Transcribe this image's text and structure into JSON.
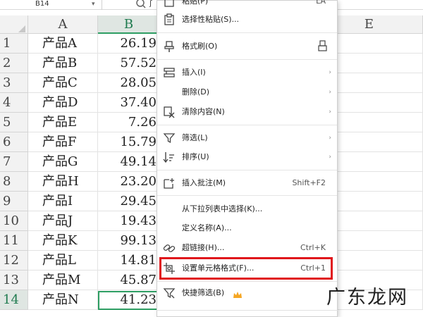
{
  "formula_bar": {
    "name_box": "B14",
    "name_box_caret": "▾",
    "formula_fragment": "ʃ"
  },
  "columns": [
    "A",
    "B",
    "E"
  ],
  "rows": [
    {
      "num": "1",
      "a": "产品A",
      "b": "26.19"
    },
    {
      "num": "2",
      "a": "产品B",
      "b": "57.52"
    },
    {
      "num": "3",
      "a": "产品C",
      "b": "28.05"
    },
    {
      "num": "4",
      "a": "产品D",
      "b": "37.40"
    },
    {
      "num": "5",
      "a": "产品E",
      "b": "7.26"
    },
    {
      "num": "6",
      "a": "产品F",
      "b": "15.79"
    },
    {
      "num": "7",
      "a": "产品G",
      "b": "49.14"
    },
    {
      "num": "8",
      "a": "产品H",
      "b": "23.20"
    },
    {
      "num": "9",
      "a": "产品I",
      "b": "29.45"
    },
    {
      "num": "10",
      "a": "产品J",
      "b": "19.43"
    },
    {
      "num": "11",
      "a": "产品K",
      "b": "99.13"
    },
    {
      "num": "12",
      "a": "产品L",
      "b": "14.81"
    },
    {
      "num": "13",
      "a": "产品M",
      "b": "45.87"
    },
    {
      "num": "14",
      "a": "产品N",
      "b": "41.23"
    }
  ],
  "context_menu": {
    "paste": {
      "label": "粘贴(P)",
      "shortcut": "LA"
    },
    "paste_special": {
      "label": "选择性粘贴(S)..."
    },
    "format_painter": {
      "label": "格式刷(O)"
    },
    "insert": {
      "label": "插入(I)"
    },
    "delete": {
      "label": "删除(D)"
    },
    "clear": {
      "label": "清除内容(N)"
    },
    "filter": {
      "label": "筛选(L)"
    },
    "sort": {
      "label": "排序(U)"
    },
    "insert_comment": {
      "label": "插入批注(M)",
      "shortcut": "Shift+F2"
    },
    "pick_from_list": {
      "label": "从下拉列表中选择(K)..."
    },
    "define_name": {
      "label": "定义名称(A)..."
    },
    "hyperlink": {
      "label": "超链接(H)...",
      "shortcut": "Ctrl+K"
    },
    "format_cells": {
      "label": "设置单元格格式(F)...",
      "shortcut": "Ctrl+1"
    },
    "quick_filter": {
      "label": "快捷筛选(B)"
    }
  },
  "submenu_arrow": "›",
  "watermark": "广东龙网",
  "colors": {
    "accent": "#2e9e63",
    "highlight": "#e0171b",
    "crown": "#f5a623"
  }
}
